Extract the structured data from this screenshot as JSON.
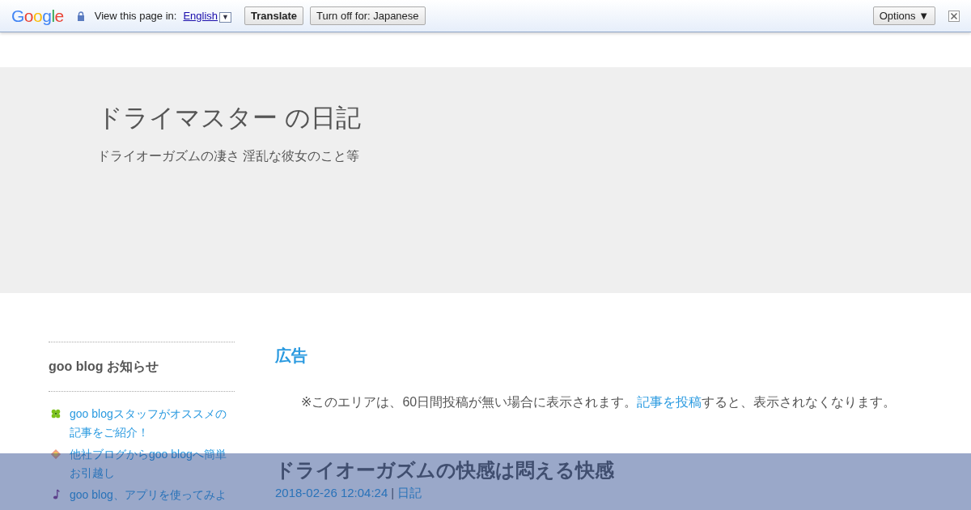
{
  "translate_bar": {
    "logo": "Google",
    "prompt": "View this page in:",
    "language": "English",
    "language_caret": "▼",
    "buttons": [
      "Translate",
      "Turn off for: Japanese"
    ],
    "options": "Options ▼"
  },
  "header": {
    "title": "ドライマスター の日記",
    "description": "ドライオーガズムの凄さ 淫乱な彼女のこと等"
  },
  "sidebar": {
    "heading": "goo blog お知らせ",
    "items": [
      {
        "text": "goo blogスタッフがオススメの記事をご紹介！"
      },
      {
        "text": "他社ブログからgoo blogへ簡単お引越し"
      },
      {
        "text": "goo blog、アプリを使ってみよ"
      }
    ]
  },
  "ad": {
    "heading": "広告",
    "notice_before": "※このエリアは、60日間投稿が無い場合に表示されます。",
    "notice_link": "記事を投稿",
    "notice_after": "すると、表示されなくなります。"
  },
  "post": {
    "title": "ドライオーガズムの快感は悶える快感",
    "date": "2018-02-26 12:04:24",
    "separator": "|",
    "category": "日記"
  }
}
